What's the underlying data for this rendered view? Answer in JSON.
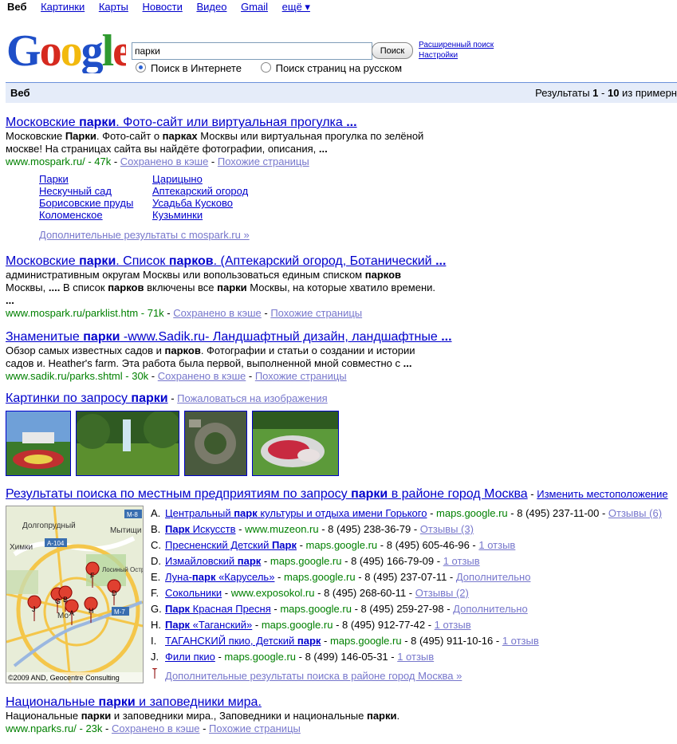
{
  "topnav": {
    "items": [
      "Веб",
      "Картинки",
      "Карты",
      "Новости",
      "Видео",
      "Gmail",
      "ещё ▾"
    ]
  },
  "logo": {
    "text": "Google"
  },
  "search": {
    "query": "парки",
    "button": "Поиск",
    "advanced": "Расширенный поиск",
    "settings": "Настройки",
    "radio_web": "Поиск в Интернете",
    "radio_ru": "Поиск страниц на русском"
  },
  "resbar": {
    "label": "Веб",
    "results_prefix": "Результаты ",
    "from": "1",
    "dash": " - ",
    "to": "10",
    "suffix": " из примерн"
  },
  "common": {
    "cached": "Сохранено в кэше",
    "similar": "Похожие страницы",
    "dash": " - "
  },
  "results": [
    {
      "title_a": "Московские ",
      "title_b": "парки",
      "title_c": ". Фото-сайт или виртуальная прогулка ",
      "title_d": "...",
      "snip1_a": "Московские ",
      "snip1_b": "Парки",
      "snip1_c": ". Фото-сайт о ",
      "snip1_d": "парках",
      "snip1_e": " Москвы или виртуальная прогулка по зелёной",
      "snip2_a": "москве! На страницах сайта вы найдёте фотографии, описания, ",
      "snip2_b": "...",
      "url": "www.mospark.ru/",
      "size": "47k"
    },
    {
      "title_a": "Московские ",
      "title_b": "парки",
      "title_c": ". Список ",
      "title_d": "парков",
      "title_e": ". (Аптекарский огород, Ботанический ",
      "title_f": "...",
      "snip1_a": "административным округам Москвы или вопользоваться единым списком ",
      "snip1_b": "парков",
      "snip2_a": "Москвы, ",
      "snip2_b": "....",
      "snip2_c": " В список ",
      "snip2_d": "парков",
      "snip2_e": " включены все ",
      "snip2_f": "парки",
      "snip2_g": " Москвы, на которые хватило времени.",
      "snip3": "...",
      "url": "www.mospark.ru/parklist.htm",
      "size": "71k"
    },
    {
      "title_a": "Знаменитые ",
      "title_b": "парки",
      "title_c": " -www.Sadik.ru- Ландшафтный дизайн, ландшафтные ",
      "title_d": "...",
      "snip1_a": "Обзор самых известных садов и ",
      "snip1_b": "парков",
      "snip1_c": ". Фотографии и статьи о создании и истории",
      "snip2_a": "садов и. Heather's farm. Эта работа была первой, выполненной мной совместно с ",
      "snip2_b": "...",
      "url": "www.sadik.ru/parks.shtml",
      "size": "30k"
    }
  ],
  "sitelinks": {
    "col1": [
      "Парки",
      "Нескучный сад",
      "Борисовские пруды",
      "Коломенское"
    ],
    "col2": [
      "Царицыно",
      "Аптекарский огород",
      "Усадьба Кусково",
      "Кузьминки"
    ],
    "more": "Дополнительные результаты с mospark.ru »"
  },
  "images": {
    "head_a": "Картинки по запросу ",
    "head_b": "парки",
    "report": "Пожаловаться на изображения"
  },
  "local": {
    "head_a": "Результаты поиска по местным предприятиям по запросу ",
    "head_b": "парки",
    "head_c": " в районе город Москва",
    "change": "Изменить местоположение",
    "more": "Дополнительные результаты поиска в районе город Москва »",
    "map_copyright": "©2009 AND, Geocentre Consulting",
    "map_labels": [
      "Долгопрудный",
      "Мытищи",
      "Химки",
      "М-8",
      "А-104",
      "Лосиный Остров",
      "М-7",
      "Мо"
    ],
    "items": [
      {
        "letter": "A.",
        "name_a": "Центральный ",
        "name_b": "парк",
        "name_c": " культуры и отдыха имени Горького",
        "site": "maps.google.ru",
        "phone": "8 (495) 237-11-00",
        "extra": "Отзывы (6)"
      },
      {
        "letter": "B.",
        "name_a": "",
        "name_b": "Парк",
        "name_c": " Искусств",
        "site": "www.muzeon.ru",
        "phone": "8 (495) 238-36-79",
        "extra": "Отзывы (3)"
      },
      {
        "letter": "C.",
        "name_a": "Пресненский Детский ",
        "name_b": "Парк",
        "name_c": "",
        "site": "maps.google.ru",
        "phone": "8 (495) 605-46-96",
        "extra": "1 отзыв"
      },
      {
        "letter": "D.",
        "name_a": "Измайловский ",
        "name_b": "парк",
        "name_c": "",
        "site": "maps.google.ru",
        "phone": "8 (495) 166-79-09",
        "extra": "1 отзыв"
      },
      {
        "letter": "E.",
        "name_a": "Луна-",
        "name_b": "парк",
        "name_c": " «Карусель»",
        "site": "maps.google.ru",
        "phone": "8 (495) 237-07-11",
        "extra": "Дополнительно"
      },
      {
        "letter": "F.",
        "name_a": "Сокольники",
        "name_b": "",
        "name_c": "",
        "site": "www.exposokol.ru",
        "phone": "8 (495) 268-60-11",
        "extra": "Отзывы (2)"
      },
      {
        "letter": "G.",
        "name_a": "",
        "name_b": "Парк",
        "name_c": " Красная Пресня",
        "site": "maps.google.ru",
        "phone": "8 (495) 259-27-98",
        "extra": "Дополнительно"
      },
      {
        "letter": "H.",
        "name_a": "",
        "name_b": "Парк",
        "name_c": " «Таганский»",
        "site": "maps.google.ru",
        "phone": "8 (495) 912-77-42",
        "extra": "1 отзыв"
      },
      {
        "letter": "I.",
        "name_a": "ТАГАНСКИЙ пкио, Детский ",
        "name_b": "парк",
        "name_c": "",
        "site": "maps.google.ru",
        "phone": "8 (495) 911-10-16",
        "extra": "1 отзыв"
      },
      {
        "letter": "J.",
        "name_a": "Фили пкио",
        "name_b": "",
        "name_c": "",
        "site": "maps.google.ru",
        "phone": "8 (499) 146-05-31",
        "extra": "1 отзыв"
      }
    ],
    "markers": [
      "J",
      "G",
      "B",
      "A",
      "H",
      "D",
      "F"
    ]
  },
  "last_result": {
    "title_a": "Национальные ",
    "title_b": "парки",
    "title_c": " и заповедники мира.",
    "snip_a": "Национальные ",
    "snip_b": "парки",
    "snip_c": " и заповедники мира., Заповедники и национальные ",
    "snip_d": "парки",
    "snip_e": ".",
    "url": "www.nparks.ru/",
    "size": "23k"
  },
  "colors": {
    "link": "#0000cc",
    "url_green": "#008000",
    "bar_bg": "#e5ecf9",
    "bar_border": "#6b90da"
  }
}
